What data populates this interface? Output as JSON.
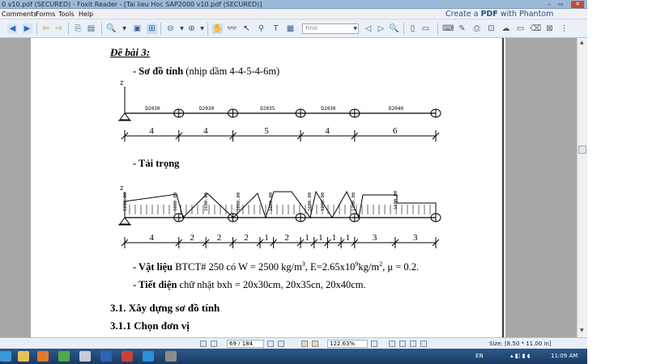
{
  "window": {
    "title": "0 v10.pdf (SECURED) - Foxit Reader - [Tai lieu Hoc SAP2000 v10.pdf (SECURED)]",
    "minimize_glyph": "–",
    "restore_glyph": "▭",
    "close_glyph": "✕"
  },
  "menu": {
    "items": [
      "Comments",
      "Forms",
      "Tools",
      "Help"
    ],
    "promo_prefix": "Create a ",
    "promo_bold": "PDF",
    "promo_suffix": " with Phantom"
  },
  "toolbar": {
    "find_placeholder": "Find"
  },
  "document": {
    "heading": "Đề bài 3:",
    "section_diagram_label": "- Sơ đồ tính",
    "section_diagram_note": " (nhịp dầm 4-4-5-4-6m)",
    "section_load_label": "- Tải trọng",
    "material_label": "- Vật liệu",
    "material_text": " BTCT# 250 có W = 2500 kg/m",
    "material_exp1": "3",
    "material_text2": ", E=2.65x10",
    "material_exp2": "9",
    "material_text3": "kg/m",
    "material_exp3": "2",
    "material_text4": ", μ = 0.2.",
    "section_label": "- Tiết diện",
    "section_text": " chữ nhật bxh = 20x30cm, 20x35cn, 20x40cm.",
    "h31": "3.1. Xây dựng sơ đồ tính",
    "h311": "3.1.1 Chọn đơn vị",
    "axis_z": "Z",
    "beam_labels": [
      "D2030",
      "D2030",
      "D2035",
      "D2030",
      "D2040"
    ],
    "spans_top": [
      "4",
      "4",
      "5",
      "4",
      "6"
    ],
    "spans_bottom": [
      "4",
      "2",
      "2",
      "2",
      "1",
      "2",
      "1",
      "1",
      "1",
      "1",
      "3",
      "3"
    ],
    "load_labels": [
      "1200.00",
      "1600.00",
      "1600.00",
      "1600.00",
      "1600.00",
      "1600.00",
      "1200.00",
      "1200.00",
      "1600.00"
    ]
  },
  "statusbar": {
    "page": "69 / 184",
    "zoom": "122.63%",
    "size": "Size: [8.50 * 11.00 in]"
  },
  "taskbar": {
    "lang": "EN",
    "time": "11:09 AM"
  },
  "colors": {
    "titlebar": "#9db9d8",
    "toolbar": "#eaf0f7",
    "pane_grey": "#a7a7a7",
    "taskbar": "#1f4470"
  }
}
